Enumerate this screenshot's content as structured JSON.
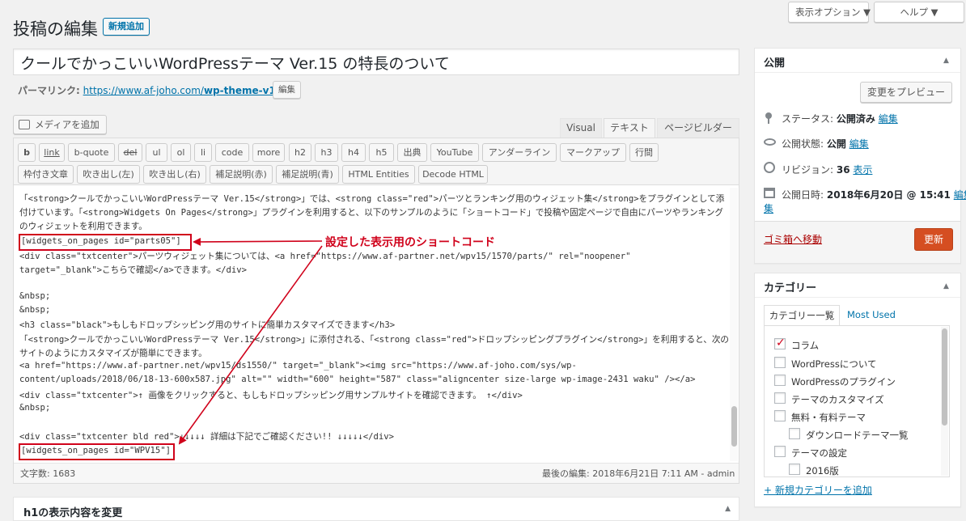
{
  "screen": {
    "options_button": "表示オプション ▼",
    "help_button": "ヘルプ ▼"
  },
  "header": {
    "title": "投稿の編集",
    "add_new": "新規追加"
  },
  "post": {
    "title": "クールでかっこいいWordPressテーマ Ver.15 の特長のついて",
    "permalink_label": "パーマリンク:",
    "permalink_base": "https://www.af-joho.com/",
    "permalink_slug": "wp-theme-v15",
    "permalink_tail": "/",
    "edit_button": "編集"
  },
  "editor": {
    "media_button": "メディアを追加",
    "tabs": [
      "Visual",
      "テキスト",
      "ページビルダー"
    ],
    "quicktags_row1": [
      "b",
      "link",
      "b-quote",
      "del",
      "ul",
      "ol",
      "li",
      "code",
      "more",
      "h2",
      "h3",
      "h4",
      "h5",
      "出典",
      "YouTube",
      "アンダーライン",
      "マークアップ",
      "行間"
    ],
    "quicktags_row2": [
      "枠付き文章",
      "吹き出し(左)",
      "吹き出し(右)",
      "補足説明(赤)",
      "補足説明(青)",
      "HTML Entities",
      "Decode HTML"
    ],
    "lines": [
      "「<strong>クールでかっこいいWordPressテーマ Ver.15</strong>」では、<strong class=\"red\">パーツとランキング用のウィジェット集</strong>をプラグインとして添",
      "付けています。「<strong>Widgets On Pages</strong>」プラグインを利用すると、以下のサンプルのように「ショートコード」で投稿や固定ページで自由にパーツやランキング",
      "のウィジェットを利用できます。",
      "[widgets_on_pages id=\"parts05\"]",
      "<div class=\"txtcenter\">パーツウィジェット集については、<a href=\"https://www.af-partner.net/wpv15/1570/parts/\" rel=\"noopener\"",
      "target=\"_blank\">こちらで確認</a>できます。</div>",
      "",
      "&nbsp;",
      "&nbsp;",
      "<h3 class=\"black\">もしもドロップシッピング用のサイトに簡単カスタマイズできます</h3>",
      "「<strong>クールでかっこいいWordPressテーマ Ver.15</strong>」に添付される、「<strong class=\"red\">ドロップシッピングプラグイン</strong>」を利用すると、次の",
      "サイトのようにカスタマイズが簡単にできます。",
      "<a href=\"https://www.af-partner.net/wpv15/ds1550/\" target=\"_blank\"><img src=\"https://www.af-joho.com/sys/wp-",
      "content/uploads/2018/06/18-13-600x587.jpg\" alt=\"\" width=\"600\" height=\"587\" class=\"aligncenter size-large wp-image-2431 waku\" /></a>",
      "<div class=\"txtcenter\">↑ 画像をクリックすると、もしもドロップシッピング用サンプルサイトを確認できます。 ↑</div>",
      "&nbsp;",
      "",
      "<div class=\"txtcenter bld red\">↓↓↓↓↓  詳細は下記でご確認ください!!  ↓↓↓↓↓</div>",
      "[widgets_on_pages id=\"WPV15\"]"
    ],
    "annotation": "設定した表示用のショートコード",
    "word_count": "文字数: 1683",
    "last_edit": "最後の編集: 2018年6月21日 7:11 AM - admin"
  },
  "h1_box": {
    "title": "h1の表示内容を変更"
  },
  "publish": {
    "title": "公開",
    "preview_button": "変更をプレビュー",
    "status_label": "ステータス:",
    "status_value": "公開済み",
    "visibility_label": "公開状態:",
    "visibility_value": "公開",
    "revision_label": "リビジョン:",
    "revision_value": "36",
    "revision_link": "表示",
    "date_label": "公開日時:",
    "date_value": "2018年6月20日 @ 15:41",
    "edit_link": "編集",
    "edit_link_wrap": "集",
    "trash_link": "ゴミ箱へ移動",
    "update_button": "更新"
  },
  "categories": {
    "title": "カテゴリー",
    "tab_all": "カテゴリー一覧",
    "tab_used": "Most Used",
    "items": [
      {
        "label": "コラム",
        "checked": true
      },
      {
        "label": "WordPressについて",
        "checked": false
      },
      {
        "label": "WordPressのプラグイン",
        "checked": false
      },
      {
        "label": "テーマのカスタマイズ",
        "checked": false
      },
      {
        "label": "無料・有料テーマ",
        "checked": false
      },
      {
        "label": "ダウンロードテーマ一覧",
        "checked": false
      },
      {
        "label": "テーマの設定",
        "checked": false
      },
      {
        "label": "2016版",
        "checked": false
      }
    ],
    "add_link": "+ 新規カテゴリーを追加"
  },
  "colors": {
    "accent": "#0073aa",
    "update_button": "#d54e21",
    "annotation": "#d0021b"
  }
}
